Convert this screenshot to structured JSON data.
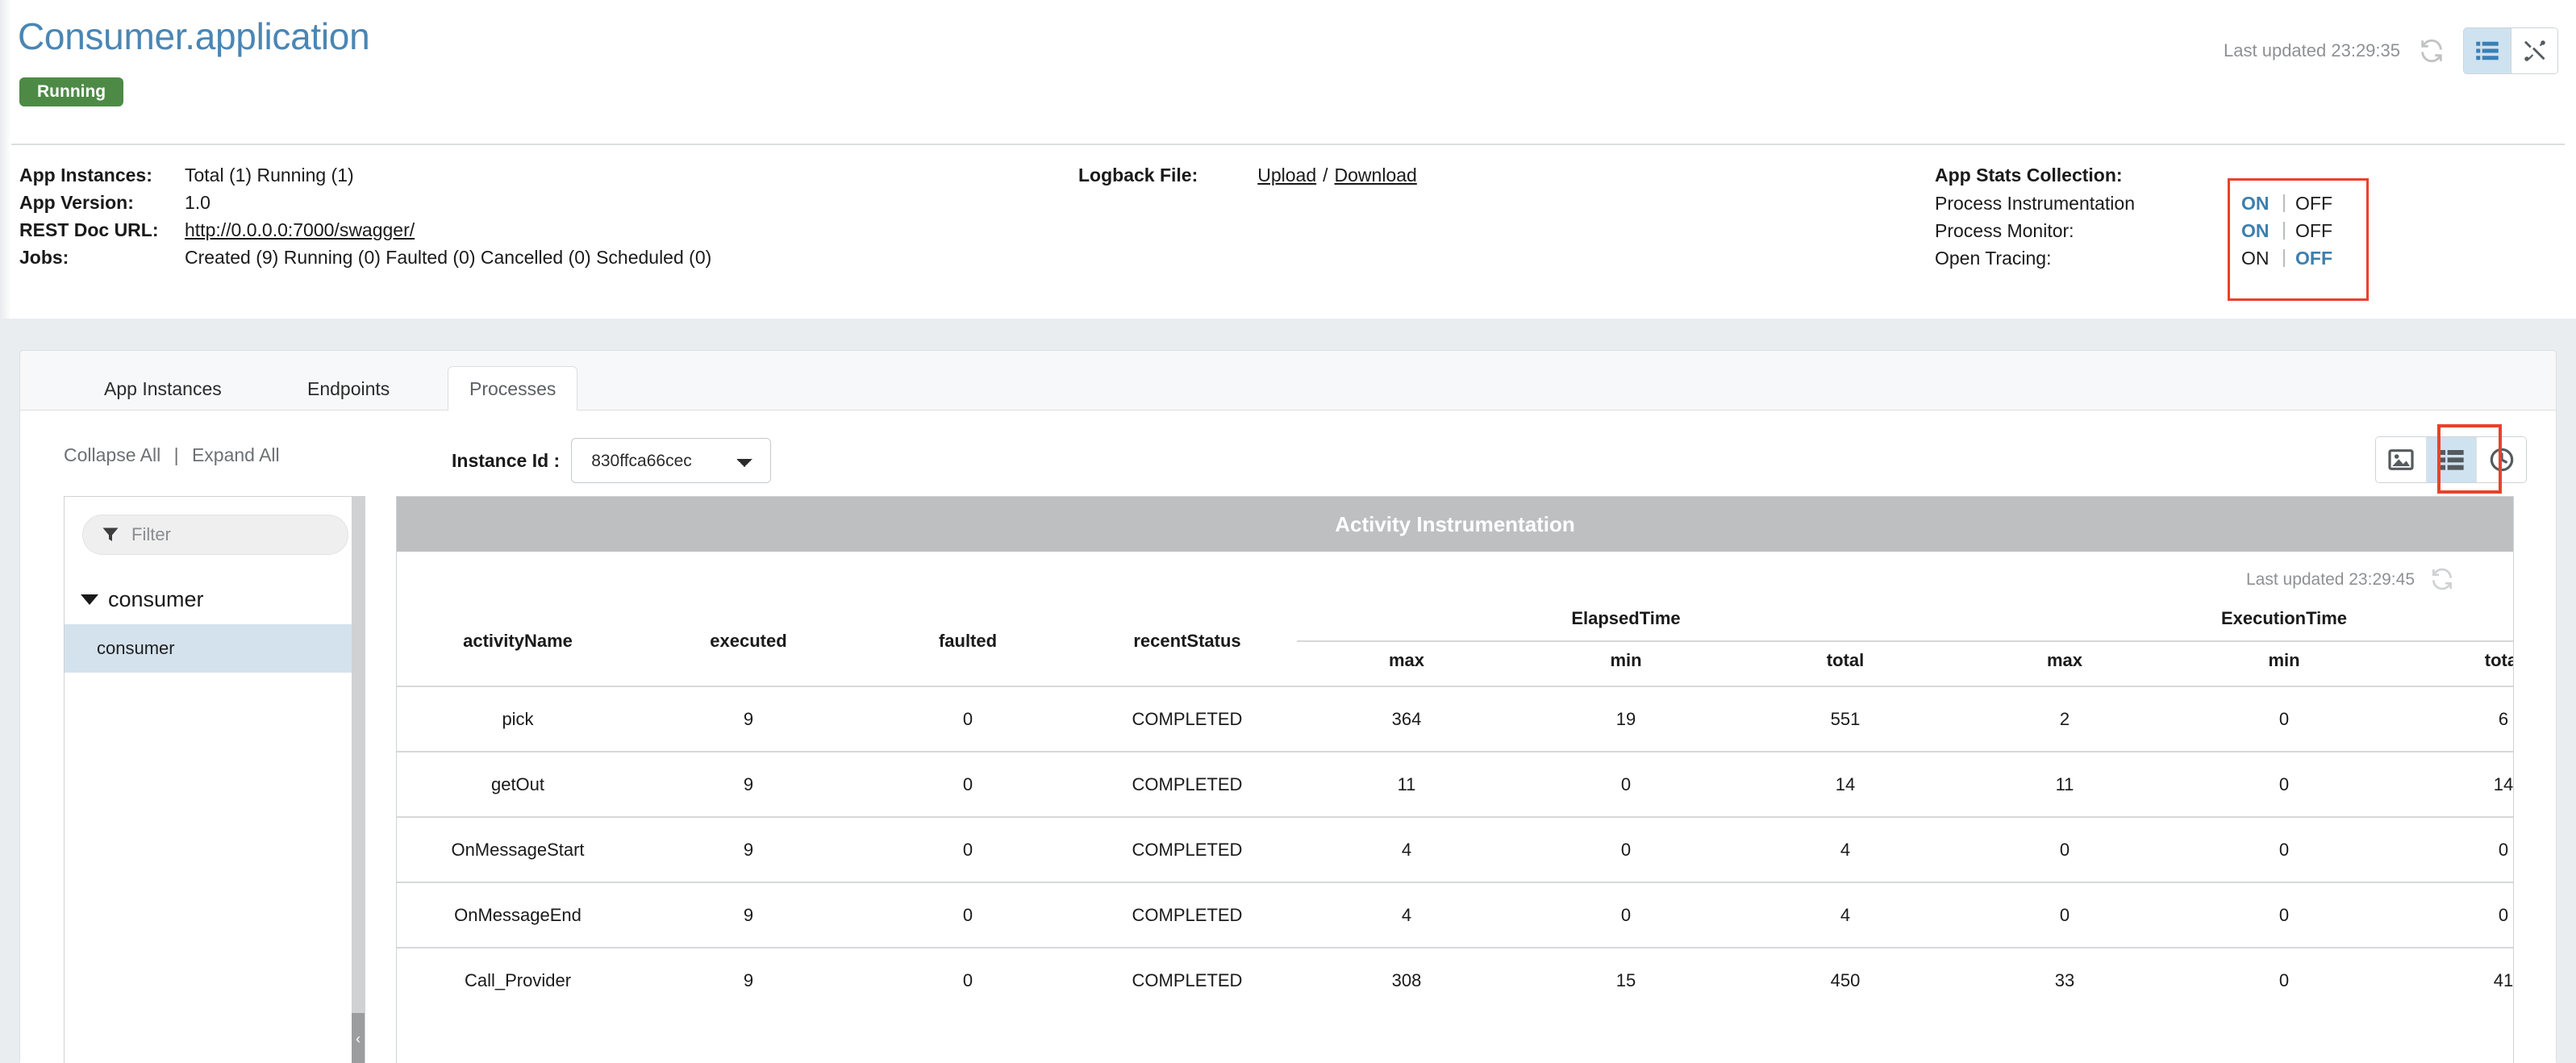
{
  "header": {
    "title": "Consumer.application",
    "status": "Running",
    "last_updated": "Last updated 23:29:35",
    "refresh_icon": "refresh-icon",
    "view_icons": [
      {
        "name": "list-view-icon",
        "active": true
      },
      {
        "name": "tools-icon",
        "active": false
      }
    ]
  },
  "info": {
    "rows": [
      {
        "label": "App Instances:",
        "value": "Total (1) Running (1)",
        "link": false
      },
      {
        "label": "App Version:",
        "value": "1.0",
        "link": false
      },
      {
        "label": "REST Doc URL:",
        "value": "http://0.0.0.0:7000/swagger/",
        "link": true
      },
      {
        "label": "Jobs:",
        "value": "Created (9) Running (0) Faulted (0) Cancelled (0) Scheduled (0)",
        "link": false
      }
    ],
    "logback": {
      "label": "Logback File:",
      "upload": "Upload",
      "separator": "/",
      "download": "Download"
    },
    "stats": {
      "title": "App Stats Collection:",
      "rows": [
        {
          "name": "Process Instrumentation",
          "on": "ON",
          "off": "OFF",
          "selected": "on"
        },
        {
          "name": "Process Monitor:",
          "on": "ON",
          "off": "OFF",
          "selected": "on"
        },
        {
          "name": "Open Tracing:",
          "on": "ON",
          "off": "OFF",
          "selected": "off"
        }
      ],
      "highlight_color": "#e8422a",
      "active_color": "#3c7fae"
    }
  },
  "tabs": [
    {
      "label": "App Instances",
      "active": false
    },
    {
      "label": "Endpoints",
      "active": false
    },
    {
      "label": "Processes",
      "active": true
    }
  ],
  "toolbar": {
    "collapse_all": "Collapse All",
    "divider": "|",
    "expand_all": "Expand All",
    "instance_label": "Instance Id :",
    "instance_value": "830ffca66cec",
    "view_icons": [
      {
        "name": "image-view-icon",
        "active": false
      },
      {
        "name": "list-view-icon",
        "active": true
      },
      {
        "name": "clock-view-icon",
        "active": false
      }
    ]
  },
  "sidebar": {
    "filter_placeholder": "Filter",
    "filter_value": "",
    "filter_icon": "funnel-icon",
    "root": "consumer",
    "child": "consumer",
    "collapse_handle": "‹"
  },
  "card": {
    "title": "Activity Instrumentation",
    "last_updated": "Last updated 23:29:45",
    "refresh_icon": "refresh-icon"
  },
  "table": {
    "group_headers": [
      {
        "label": "activityName",
        "span": 1
      },
      {
        "label": "executed",
        "span": 1
      },
      {
        "label": "faulted",
        "span": 1
      },
      {
        "label": "recentStatus",
        "span": 1
      },
      {
        "label": "ElapsedTime",
        "span": 3
      },
      {
        "label": "ExecutionTime",
        "span": 3
      }
    ],
    "sub_headers": [
      "",
      "",
      "",
      "",
      "max",
      "min",
      "total",
      "max",
      "min",
      "total"
    ],
    "rows": [
      {
        "activityName": "pick",
        "executed": "9",
        "faulted": "0",
        "recentStatus": "COMPLETED",
        "elapsed_max": "364",
        "elapsed_min": "19",
        "elapsed_total": "551",
        "exec_max": "2",
        "exec_min": "0",
        "exec_total": "6"
      },
      {
        "activityName": "getOut",
        "executed": "9",
        "faulted": "0",
        "recentStatus": "COMPLETED",
        "elapsed_max": "11",
        "elapsed_min": "0",
        "elapsed_total": "14",
        "exec_max": "11",
        "exec_min": "0",
        "exec_total": "14"
      },
      {
        "activityName": "OnMessageStart",
        "executed": "9",
        "faulted": "0",
        "recentStatus": "COMPLETED",
        "elapsed_max": "4",
        "elapsed_min": "0",
        "elapsed_total": "4",
        "exec_max": "0",
        "exec_min": "0",
        "exec_total": "0"
      },
      {
        "activityName": "OnMessageEnd",
        "executed": "9",
        "faulted": "0",
        "recentStatus": "COMPLETED",
        "elapsed_max": "4",
        "elapsed_min": "0",
        "elapsed_total": "4",
        "exec_max": "0",
        "exec_min": "0",
        "exec_total": "0"
      },
      {
        "activityName": "Call_Provider",
        "executed": "9",
        "faulted": "0",
        "recentStatus": "COMPLETED",
        "elapsed_max": "308",
        "elapsed_min": "15",
        "elapsed_total": "450",
        "exec_max": "33",
        "exec_min": "0",
        "exec_total": "41"
      }
    ]
  }
}
